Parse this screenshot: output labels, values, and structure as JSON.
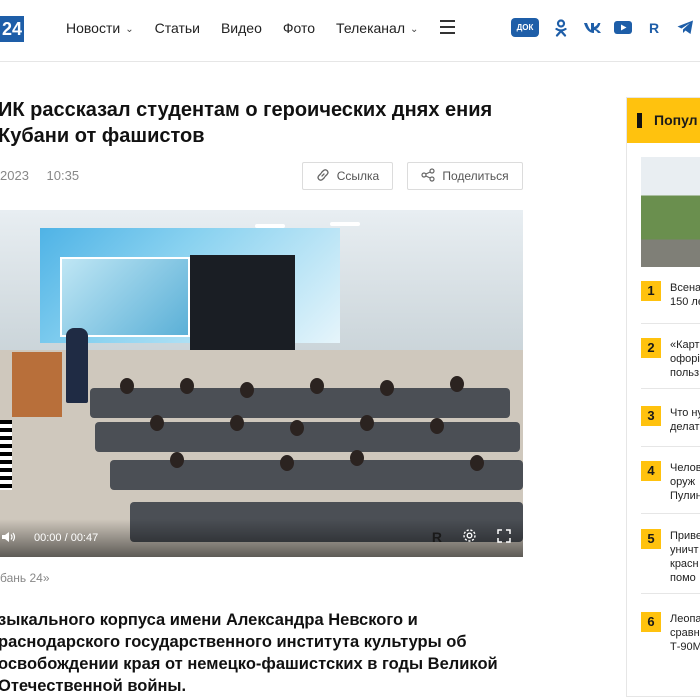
{
  "header": {
    "logo_text": "24",
    "nav": [
      {
        "label": "Новости",
        "has_dropdown": true
      },
      {
        "label": "Статьи",
        "has_dropdown": false
      },
      {
        "label": "Видео",
        "has_dropdown": false
      },
      {
        "label": "Фото",
        "has_dropdown": false
      },
      {
        "label": "Телеканал",
        "has_dropdown": true
      }
    ],
    "socials": [
      {
        "icon": "dok-badge-icon",
        "label": "ДОК"
      },
      {
        "icon": "odnoklassniki-icon",
        "label": ""
      },
      {
        "icon": "vk-icon",
        "label": ""
      },
      {
        "icon": "youtube-icon",
        "label": ""
      },
      {
        "icon": "rutube-icon",
        "label": "R"
      },
      {
        "icon": "telegram-icon",
        "label": ""
      }
    ],
    "accent_color": "#1e5ea8"
  },
  "article": {
    "title": "ИК рассказал студентам о героических днях ения Кубани от фашистов",
    "date": "2023",
    "time": "10:35",
    "link_button": "Ссылка",
    "share_button": "Поделиться",
    "video": {
      "time_display": "00:00 / 00:47",
      "logo": "R"
    },
    "caption": "бань 24»",
    "lead": "зыкального корпуса имени Александра Невского и раснодарского государственного института культуры об освобождении края от немецко-фашистских в годы Великой Отечественной войны."
  },
  "sidebar": {
    "title": "Попул",
    "accent_color": "#ffc20e",
    "items": [
      {
        "num": "1",
        "lines": [
          "Всена",
          "150 ле"
        ]
      },
      {
        "num": "2",
        "lines": [
          "«Карт",
          "офорі",
          "польз"
        ]
      },
      {
        "num": "3",
        "lines": [
          "Что ну",
          "делат"
        ]
      },
      {
        "num": "4",
        "lines": [
          "Челов",
          "оруж",
          "Пулин"
        ]
      },
      {
        "num": "5",
        "lines": [
          "Приве",
          "уничт",
          "красн",
          "помо"
        ]
      },
      {
        "num": "6",
        "lines": [
          "Леопа",
          "сравн",
          "Т-90М"
        ]
      }
    ]
  }
}
